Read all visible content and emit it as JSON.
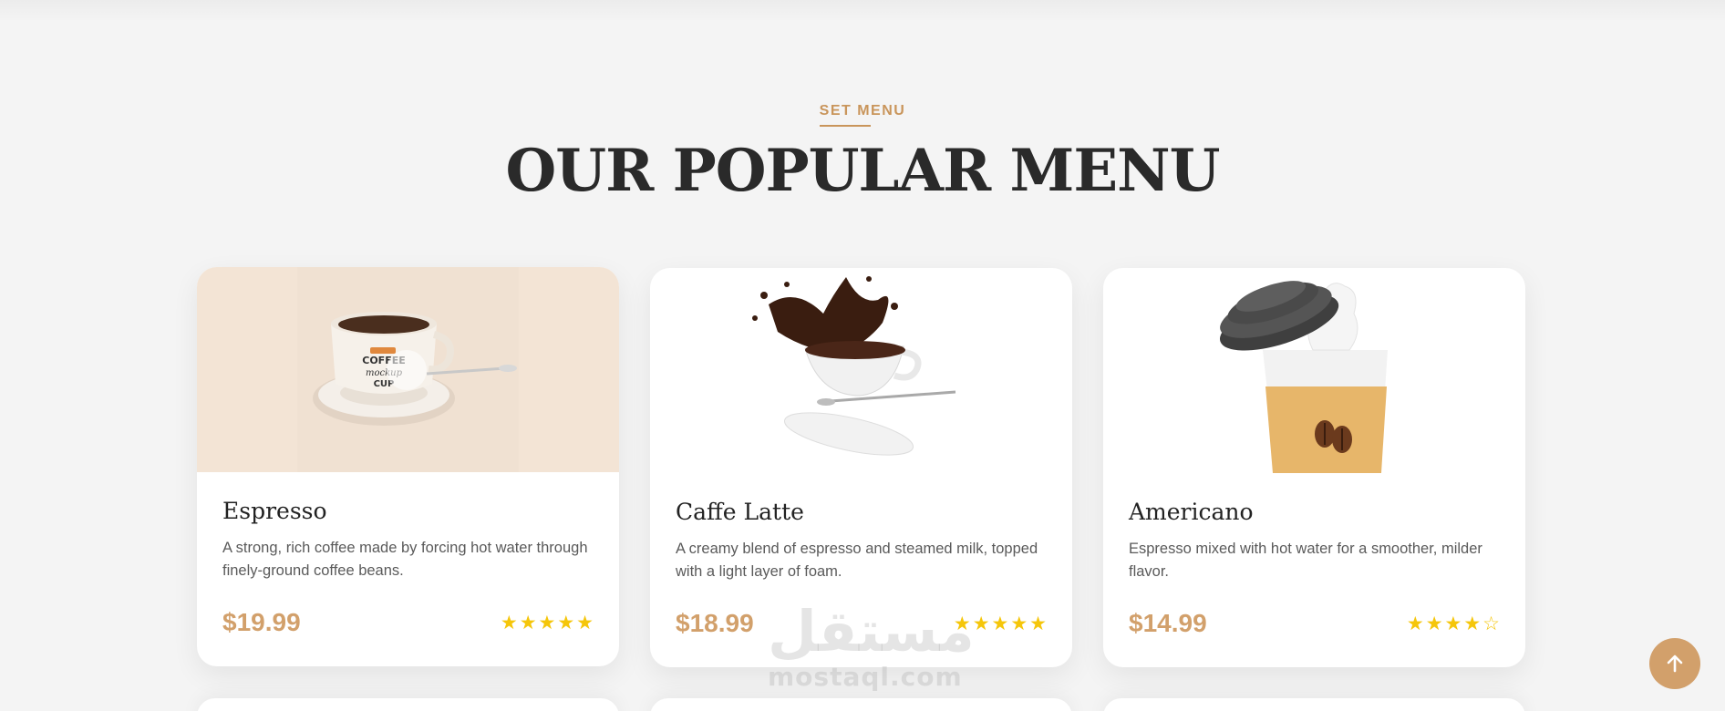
{
  "section": {
    "eyebrow": "SET MENU",
    "title": "OUR POPULAR MENU"
  },
  "menu": [
    {
      "name": "Espresso",
      "description": "A strong, rich coffee made by forcing hot water through finely-ground coffee beans.",
      "price": "$19.99",
      "rating": 5,
      "image_icon": "coffee-mockup-cup-image"
    },
    {
      "name": "Caffe Latte",
      "description": "A creamy blend of espresso and steamed milk, topped with a light layer of foam.",
      "price": "$18.99",
      "rating": 5,
      "image_icon": "coffee-splash-image"
    },
    {
      "name": "Americano",
      "description": "Espresso mixed with hot water for a smoother, milder flavor.",
      "price": "$14.99",
      "rating": 4,
      "image_icon": "takeaway-cup-image"
    }
  ],
  "scroll_top": {
    "icon": "arrow-up-icon"
  },
  "watermark": {
    "arabic": "مستقل",
    "latin": "mostaql.com"
  },
  "colors": {
    "accent": "#d2a06b",
    "star": "#f5c60a",
    "heading": "#2a2a2a"
  }
}
